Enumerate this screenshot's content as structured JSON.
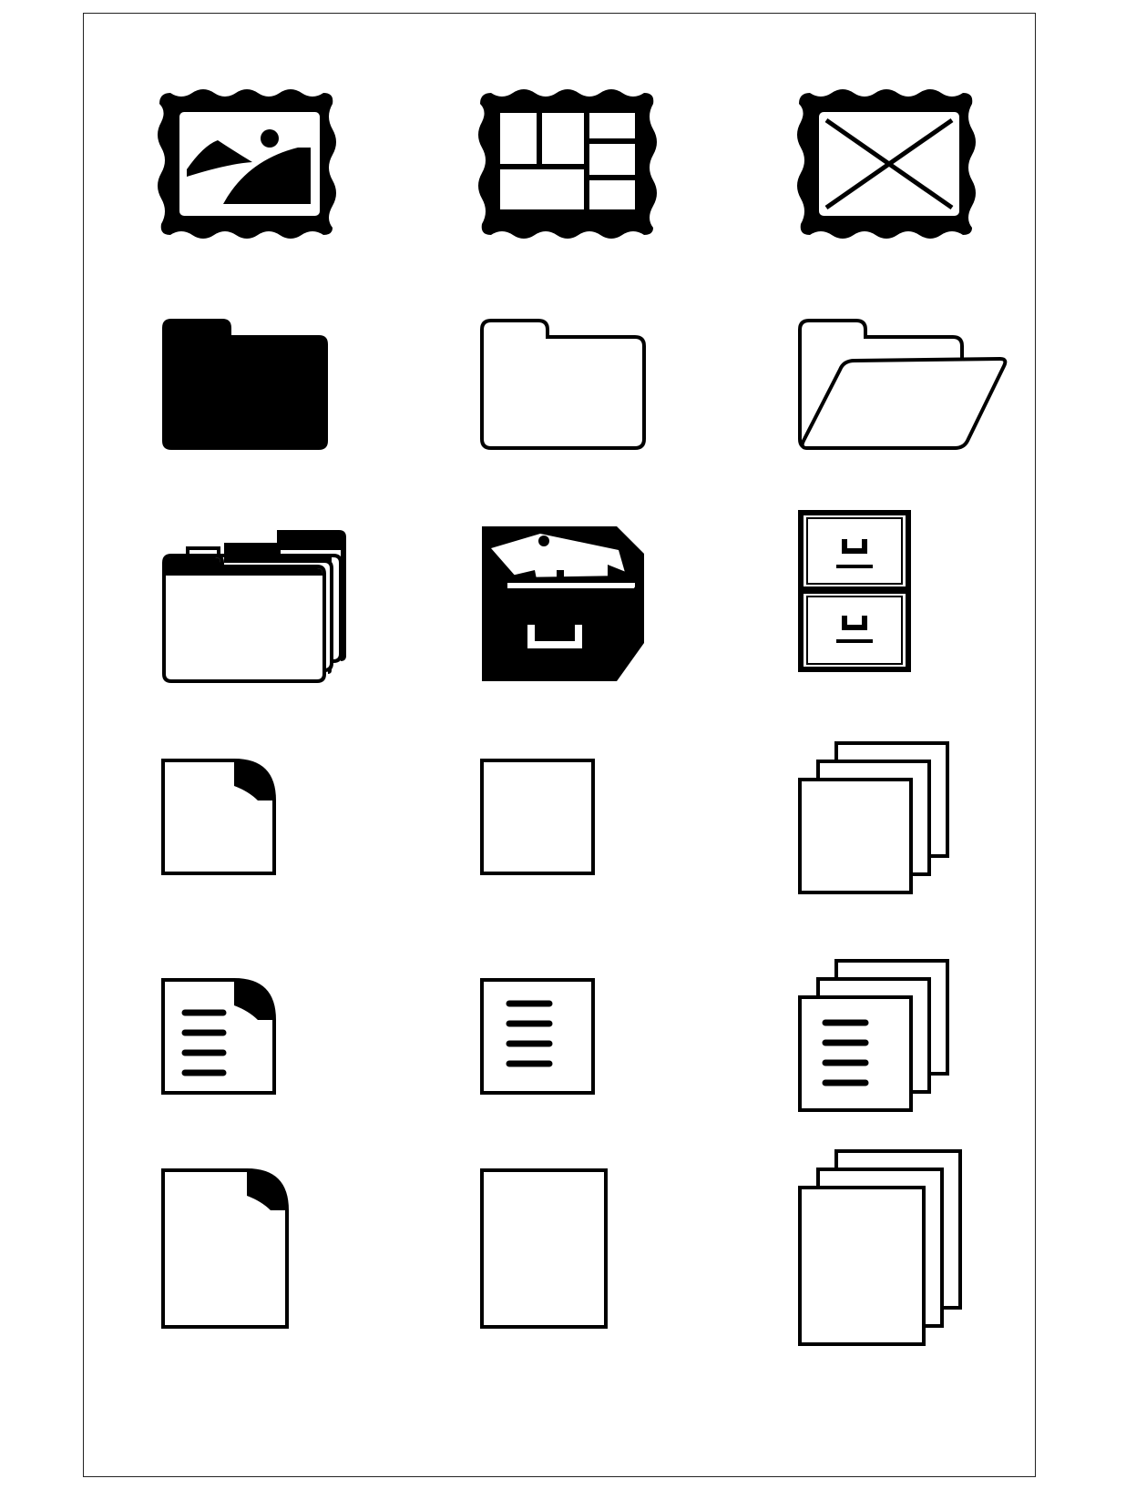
{
  "colors": {
    "ink": "#000000",
    "paper": "#ffffff",
    "border": "#222222"
  },
  "icon_sheet": {
    "rows": [
      [
        "picture-frame-landscape-icon",
        "picture-frame-grid-icon",
        "picture-frame-empty-icon"
      ],
      [
        "folder-filled-icon",
        "folder-outline-icon",
        "folder-open-icon"
      ],
      [
        "folders-stack-icon",
        "card-file-box-icon",
        "file-cabinet-icon"
      ],
      [
        "document-page-curl-icon",
        "document-blank-icon",
        "documents-stack-icon"
      ],
      [
        "document-text-curl-icon",
        "document-text-icon",
        "documents-text-stack-icon"
      ],
      [
        "page-tall-curl-icon",
        "page-tall-blank-icon",
        "pages-tall-stack-icon"
      ]
    ]
  }
}
